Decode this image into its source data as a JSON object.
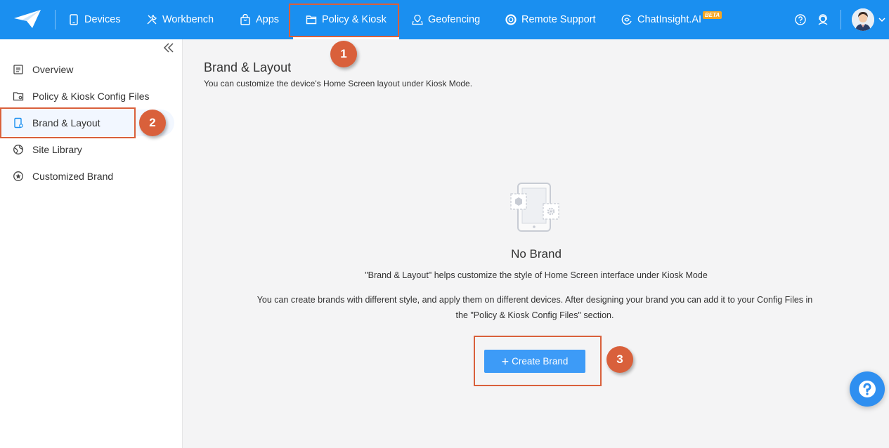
{
  "nav": {
    "items": [
      {
        "label": "Devices",
        "icon": "tablet-icon"
      },
      {
        "label": "Workbench",
        "icon": "tools-icon"
      },
      {
        "label": "Apps",
        "icon": "bag-icon"
      },
      {
        "label": "Policy & Kiosk",
        "icon": "folder-icon"
      },
      {
        "label": "Geofencing",
        "icon": "map-pin-icon"
      },
      {
        "label": "Remote Support",
        "icon": "lifebuoy-icon"
      },
      {
        "label": "ChatInsight.AI",
        "icon": "ai-icon"
      }
    ],
    "active": "Policy & Kiosk",
    "beta_badge": "BETA"
  },
  "sidebar": {
    "items": [
      {
        "label": "Overview",
        "icon": "list-icon"
      },
      {
        "label": "Policy & Kiosk Config Files",
        "icon": "folder-settings-icon"
      },
      {
        "label": "Brand & Layout",
        "icon": "device-layout-icon"
      },
      {
        "label": "Site Library",
        "icon": "globe-icon"
      },
      {
        "label": "Customized Brand",
        "icon": "star-circle-icon"
      }
    ],
    "active": "Brand & Layout"
  },
  "main": {
    "title": "Brand & Layout",
    "subtitle": "You can customize the device's Home Screen layout under Kiosk Mode.",
    "empty_title": "No Brand",
    "empty_desc": "\"Brand & Layout\" helps customize the style of Home Screen interface under Kiosk Mode",
    "empty_desc2": "You can create brands with different style, and apply them on different devices. After designing your brand you can add it to your Config Files in the \"Policy & Kiosk Config Files\" section.",
    "create_button": "Create Brand"
  },
  "annotations": {
    "markers": [
      "1",
      "2",
      "3"
    ],
    "color": "#d9603b"
  },
  "colors": {
    "brand": "#1a8ff0",
    "button": "#3d9bf7"
  }
}
